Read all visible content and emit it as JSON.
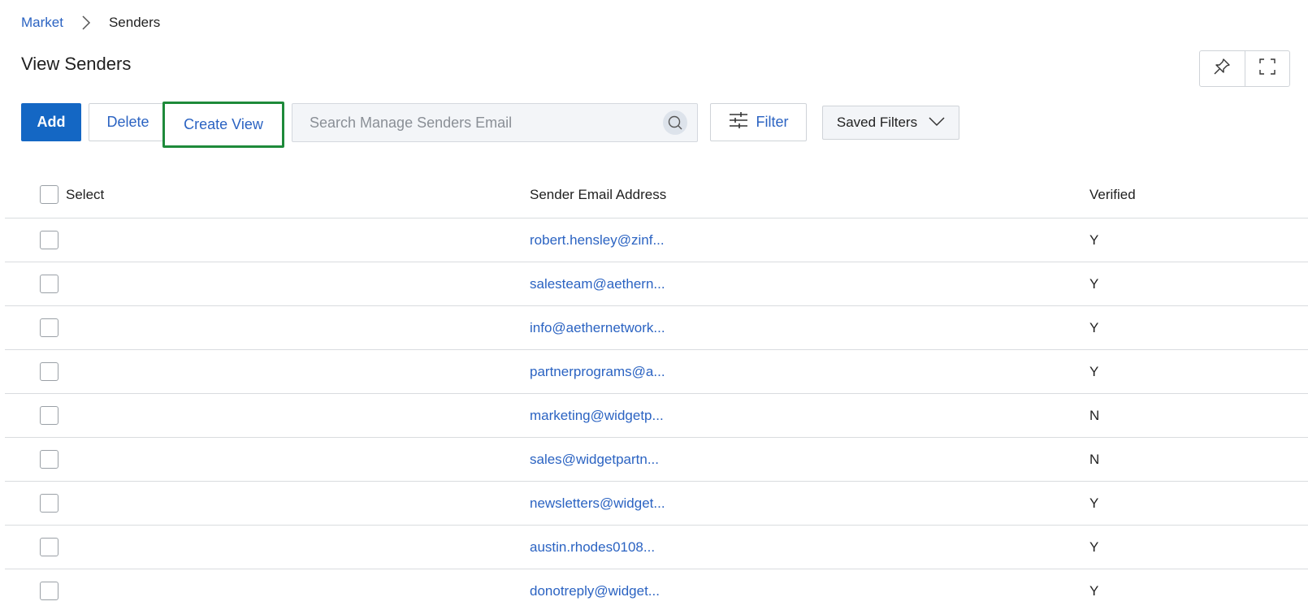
{
  "breadcrumb": {
    "parent": "Market",
    "current": "Senders"
  },
  "page": {
    "title": "View Senders"
  },
  "corner": {
    "pin_icon": "pin-icon",
    "expand_icon": "fullscreen-icon"
  },
  "toolbar": {
    "add_label": "Add",
    "delete_label": "Delete",
    "create_view_label": "Create View",
    "search_placeholder": "Search Manage Senders Email",
    "filter_label": "Filter",
    "saved_filters_label": "Saved Filters"
  },
  "table": {
    "columns": {
      "select": "Select",
      "email": "Sender Email Address",
      "verified": "Verified"
    },
    "rows": [
      {
        "email": "robert.hensley@zinf...",
        "verified": "Y"
      },
      {
        "email": "salesteam@aethern...",
        "verified": "Y"
      },
      {
        "email": "info@aethernetwork...",
        "verified": "Y"
      },
      {
        "email": "partnerprograms@a...",
        "verified": "Y"
      },
      {
        "email": "marketing@widgetp...",
        "verified": "N"
      },
      {
        "email": "sales@widgetpartn...",
        "verified": "N"
      },
      {
        "email": "newsletters@widget...",
        "verified": "Y"
      },
      {
        "email": "austin.rhodes0108...",
        "verified": "Y"
      },
      {
        "email": "donotreply@widget...",
        "verified": "Y"
      }
    ]
  },
  "colors": {
    "primary": "#1467c4",
    "link": "#2b63c2",
    "highlight": "#1e8a3a"
  }
}
